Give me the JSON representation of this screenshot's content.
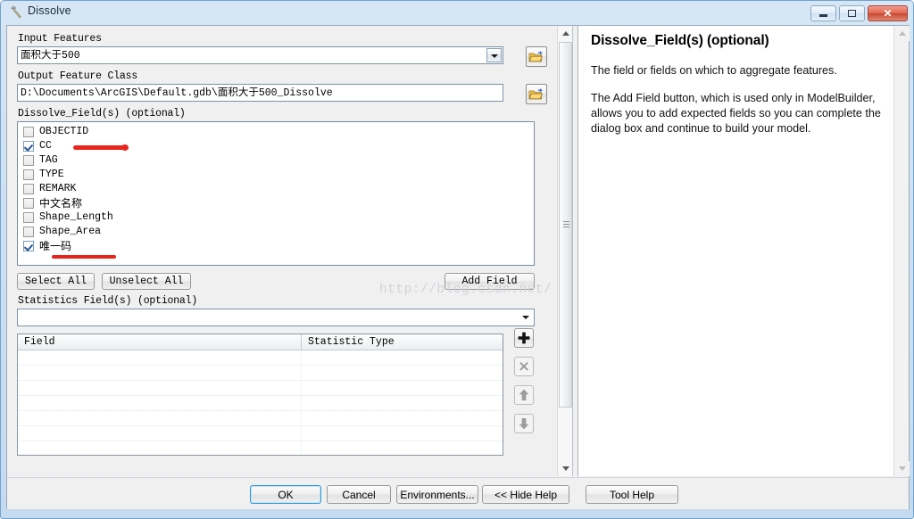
{
  "window": {
    "title": "Dissolve",
    "icon": "hammer-tool-icon",
    "minimize_label": "Minimize",
    "maximize_label": "Maximize",
    "close_label": "Close"
  },
  "form": {
    "input_features": {
      "label": "Input Features",
      "value": "面积大于500",
      "browse_icon": "open-folder-icon"
    },
    "output_feature_class": {
      "label": "Output Feature Class",
      "value": "D:\\Documents\\ArcGIS\\Default.gdb\\面积大于500_Dissolve",
      "browse_icon": "open-folder-icon"
    },
    "dissolve_fields": {
      "label": "Dissolve_Field(s)  (optional)",
      "items": [
        {
          "name": "OBJECTID",
          "checked": false,
          "cjk": false
        },
        {
          "name": "CC",
          "checked": true,
          "cjk": false
        },
        {
          "name": "TAG",
          "checked": false,
          "cjk": false
        },
        {
          "name": "TYPE",
          "checked": false,
          "cjk": false
        },
        {
          "name": "REMARK",
          "checked": false,
          "cjk": false
        },
        {
          "name": "中文名称",
          "checked": false,
          "cjk": true
        },
        {
          "name": "Shape_Length",
          "checked": false,
          "cjk": false
        },
        {
          "name": "Shape_Area",
          "checked": false,
          "cjk": false
        },
        {
          "name": "唯一码",
          "checked": true,
          "cjk": true
        }
      ],
      "select_all_label": "Select All",
      "unselect_all_label": "Unselect All",
      "add_field_label": "Add Field"
    },
    "statistics_fields": {
      "label": "Statistics Field(s)  (optional)",
      "value": "",
      "columns": [
        "Field",
        "Statistic Type"
      ],
      "rows": [],
      "row_count": 7,
      "add_icon": "plus-icon",
      "remove_icon": "cross-icon",
      "move_up_icon": "arrow-up-icon",
      "move_down_icon": "arrow-down-icon"
    }
  },
  "help": {
    "title": "Dissolve_Field(s) (optional)",
    "paragraphs": [
      "The field or fields on which to aggregate features.",
      "The Add Field button, which is used only in ModelBuilder, allows you to add expected fields so you can complete the dialog box and continue to build your model."
    ]
  },
  "footer": {
    "ok_label": "OK",
    "cancel_label": "Cancel",
    "environments_label": "Environments...",
    "hide_help_label": "<< Hide Help",
    "tool_help_label": "Tool Help"
  },
  "watermark": {
    "text": "http://blog.csdn.net/"
  },
  "colors": {
    "annotation_red": "#e8241c",
    "frame_blue": "#6fa3cf",
    "focus_blue": "#2c9bd6"
  }
}
